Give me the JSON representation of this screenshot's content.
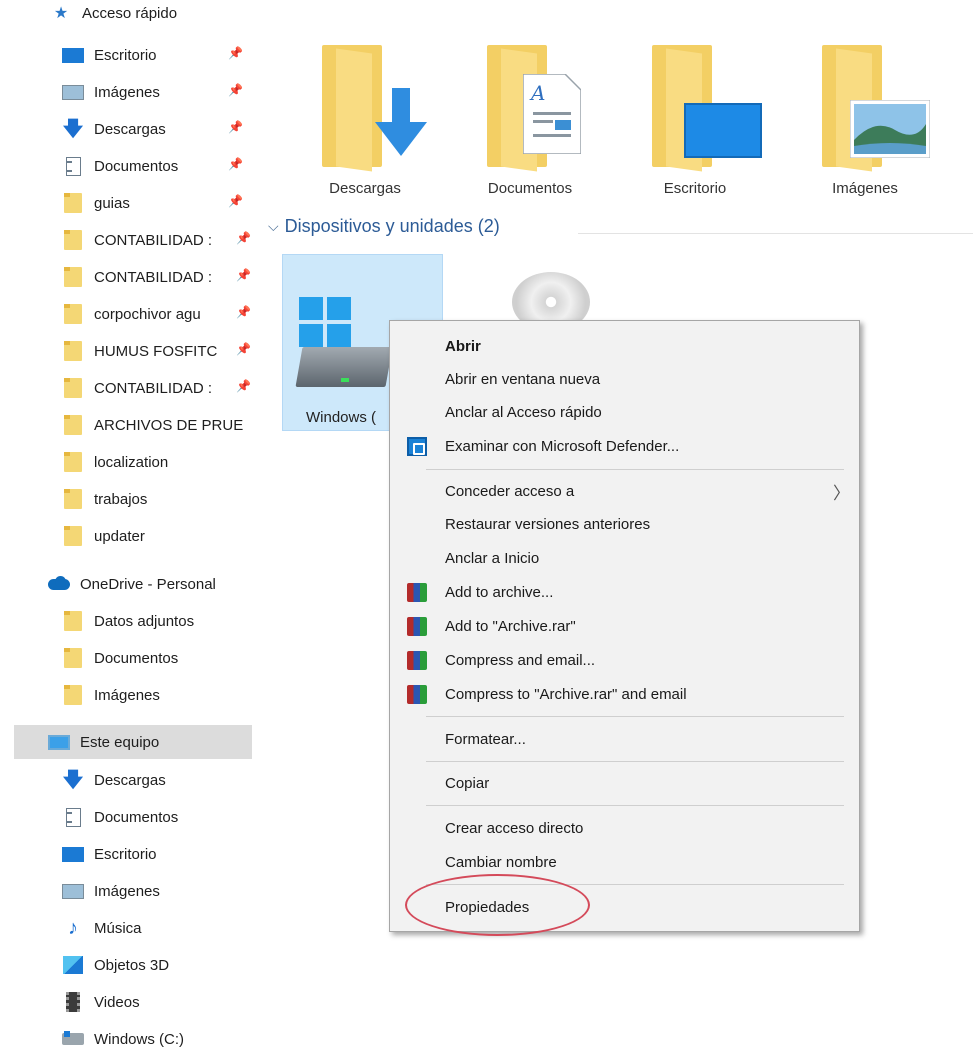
{
  "sidebar": {
    "quick_access": {
      "label": "Acceso rápido",
      "items": [
        {
          "label": "Escritorio",
          "icon": "desktop-icon",
          "pinned": true
        },
        {
          "label": "Imágenes",
          "icon": "pictures-icon",
          "pinned": true
        },
        {
          "label": "Descargas",
          "icon": "download-icon",
          "pinned": true
        },
        {
          "label": "Documentos",
          "icon": "document-icon",
          "pinned": true
        },
        {
          "label": "guias",
          "icon": "folder-icon",
          "pinned": true
        },
        {
          "label": "CONTABILIDAD :",
          "icon": "folder-icon",
          "pinned": true
        },
        {
          "label": "CONTABILIDAD :",
          "icon": "folder-icon",
          "pinned": true
        },
        {
          "label": "corpochivor agu",
          "icon": "folder-icon",
          "pinned": true
        },
        {
          "label": "HUMUS FOSFITC",
          "icon": "folder-icon",
          "pinned": true
        },
        {
          "label": "CONTABILIDAD :",
          "icon": "folder-icon",
          "pinned": true
        },
        {
          "label": "ARCHIVOS DE PRUE",
          "icon": "folder-icon",
          "pinned": false
        },
        {
          "label": "localization",
          "icon": "folder-icon",
          "pinned": false
        },
        {
          "label": "trabajos",
          "icon": "folder-icon",
          "pinned": false
        },
        {
          "label": "updater",
          "icon": "folder-icon",
          "pinned": false
        }
      ]
    },
    "onedrive": {
      "label": "OneDrive - Personal",
      "items": [
        {
          "label": "Datos adjuntos"
        },
        {
          "label": "Documentos"
        },
        {
          "label": "Imágenes"
        }
      ]
    },
    "this_pc": {
      "label": "Este equipo",
      "items": [
        {
          "label": "Descargas",
          "icon": "download-icon"
        },
        {
          "label": "Documentos",
          "icon": "document-icon"
        },
        {
          "label": "Escritorio",
          "icon": "desktop-icon"
        },
        {
          "label": "Imágenes",
          "icon": "pictures-icon"
        },
        {
          "label": "Música",
          "icon": "music-icon"
        },
        {
          "label": "Objetos 3D",
          "icon": "3d-objects-icon"
        },
        {
          "label": "Videos",
          "icon": "video-icon"
        },
        {
          "label": "Windows (C:)",
          "icon": "drive-icon"
        }
      ]
    }
  },
  "folders": [
    {
      "label": "Descargas"
    },
    {
      "label": "Documentos"
    },
    {
      "label": "Escritorio"
    },
    {
      "label": "Imágenes"
    }
  ],
  "devices": {
    "header": "Dispositivos y unidades (2)",
    "drive_label": "Windows ("
  },
  "context_menu": {
    "abrir": "Abrir",
    "abrir_ventana": "Abrir en ventana nueva",
    "anclar_acceso": "Anclar al Acceso rápido",
    "examinar_defender": "Examinar con Microsoft Defender...",
    "conceder_acceso": "Conceder acceso a",
    "restaurar_versiones": "Restaurar versiones anteriores",
    "anclar_inicio": "Anclar a Inicio",
    "add_archive": "Add to archive...",
    "add_archive_rar": "Add to \"Archive.rar\"",
    "compress_email": "Compress and email...",
    "compress_rar_email": "Compress to \"Archive.rar\" and email",
    "formatear": "Formatear...",
    "copiar": "Copiar",
    "crear_acceso": "Crear acceso directo",
    "cambiar_nombre": "Cambiar nombre",
    "propiedades": "Propiedades"
  },
  "colors": {
    "accent": "#1b7ad4",
    "selection": "#cde8fa",
    "highlight_oval": "#d44a5a"
  }
}
